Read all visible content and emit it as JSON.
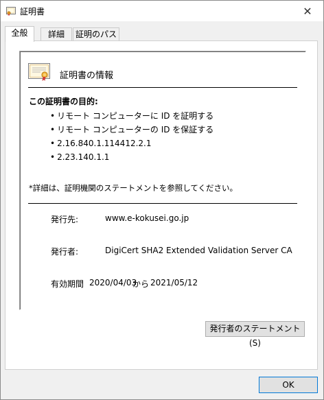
{
  "window": {
    "title": "証明書",
    "close_symbol": "✕"
  },
  "tabs": [
    {
      "label": "全般"
    },
    {
      "label": "詳細"
    },
    {
      "label": "証明のパス"
    }
  ],
  "general": {
    "info_title": "証明書の情報",
    "purpose_heading": "この証明書の目的:",
    "purposes": [
      "リモート コンピューターに ID を証明する",
      "リモート コンピューターの ID を保証する",
      "2.16.840.1.114412.2.1",
      "2.23.140.1.1"
    ],
    "note": "*詳細は、証明機関のステートメントを参照してください。",
    "issued_to_label": "発行先:",
    "issued_to_value": "www.e-kokusei.go.jp",
    "issued_by_label": "発行者:",
    "issued_by_value": "DigiCert SHA2 Extended Validation Server CA",
    "validity_label": "有効期間",
    "valid_from": "2020/04/03",
    "valid_to_word": "から",
    "valid_to": "2021/05/12"
  },
  "buttons": {
    "issuer_statement": "発行者のステートメント(S)",
    "ok": "OK"
  },
  "icons": {
    "title_icon": "certificate-icon",
    "panel_icon": "certificate-icon",
    "close_icon": "close-icon"
  }
}
